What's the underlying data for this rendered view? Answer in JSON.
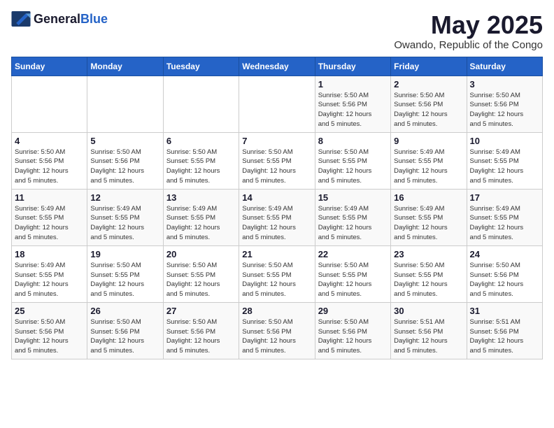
{
  "header": {
    "logo_general": "General",
    "logo_blue": "Blue",
    "month_title": "May 2025",
    "subtitle": "Owando, Republic of the Congo"
  },
  "days_of_week": [
    "Sunday",
    "Monday",
    "Tuesday",
    "Wednesday",
    "Thursday",
    "Friday",
    "Saturday"
  ],
  "weeks": [
    [
      {
        "day": "",
        "info": ""
      },
      {
        "day": "",
        "info": ""
      },
      {
        "day": "",
        "info": ""
      },
      {
        "day": "",
        "info": ""
      },
      {
        "day": "1",
        "info": "Sunrise: 5:50 AM\nSunset: 5:56 PM\nDaylight: 12 hours\nand 5 minutes."
      },
      {
        "day": "2",
        "info": "Sunrise: 5:50 AM\nSunset: 5:56 PM\nDaylight: 12 hours\nand 5 minutes."
      },
      {
        "day": "3",
        "info": "Sunrise: 5:50 AM\nSunset: 5:56 PM\nDaylight: 12 hours\nand 5 minutes."
      }
    ],
    [
      {
        "day": "4",
        "info": "Sunrise: 5:50 AM\nSunset: 5:56 PM\nDaylight: 12 hours\nand 5 minutes."
      },
      {
        "day": "5",
        "info": "Sunrise: 5:50 AM\nSunset: 5:56 PM\nDaylight: 12 hours\nand 5 minutes."
      },
      {
        "day": "6",
        "info": "Sunrise: 5:50 AM\nSunset: 5:55 PM\nDaylight: 12 hours\nand 5 minutes."
      },
      {
        "day": "7",
        "info": "Sunrise: 5:50 AM\nSunset: 5:55 PM\nDaylight: 12 hours\nand 5 minutes."
      },
      {
        "day": "8",
        "info": "Sunrise: 5:50 AM\nSunset: 5:55 PM\nDaylight: 12 hours\nand 5 minutes."
      },
      {
        "day": "9",
        "info": "Sunrise: 5:49 AM\nSunset: 5:55 PM\nDaylight: 12 hours\nand 5 minutes."
      },
      {
        "day": "10",
        "info": "Sunrise: 5:49 AM\nSunset: 5:55 PM\nDaylight: 12 hours\nand 5 minutes."
      }
    ],
    [
      {
        "day": "11",
        "info": "Sunrise: 5:49 AM\nSunset: 5:55 PM\nDaylight: 12 hours\nand 5 minutes."
      },
      {
        "day": "12",
        "info": "Sunrise: 5:49 AM\nSunset: 5:55 PM\nDaylight: 12 hours\nand 5 minutes."
      },
      {
        "day": "13",
        "info": "Sunrise: 5:49 AM\nSunset: 5:55 PM\nDaylight: 12 hours\nand 5 minutes."
      },
      {
        "day": "14",
        "info": "Sunrise: 5:49 AM\nSunset: 5:55 PM\nDaylight: 12 hours\nand 5 minutes."
      },
      {
        "day": "15",
        "info": "Sunrise: 5:49 AM\nSunset: 5:55 PM\nDaylight: 12 hours\nand 5 minutes."
      },
      {
        "day": "16",
        "info": "Sunrise: 5:49 AM\nSunset: 5:55 PM\nDaylight: 12 hours\nand 5 minutes."
      },
      {
        "day": "17",
        "info": "Sunrise: 5:49 AM\nSunset: 5:55 PM\nDaylight: 12 hours\nand 5 minutes."
      }
    ],
    [
      {
        "day": "18",
        "info": "Sunrise: 5:49 AM\nSunset: 5:55 PM\nDaylight: 12 hours\nand 5 minutes."
      },
      {
        "day": "19",
        "info": "Sunrise: 5:50 AM\nSunset: 5:55 PM\nDaylight: 12 hours\nand 5 minutes."
      },
      {
        "day": "20",
        "info": "Sunrise: 5:50 AM\nSunset: 5:55 PM\nDaylight: 12 hours\nand 5 minutes."
      },
      {
        "day": "21",
        "info": "Sunrise: 5:50 AM\nSunset: 5:55 PM\nDaylight: 12 hours\nand 5 minutes."
      },
      {
        "day": "22",
        "info": "Sunrise: 5:50 AM\nSunset: 5:55 PM\nDaylight: 12 hours\nand 5 minutes."
      },
      {
        "day": "23",
        "info": "Sunrise: 5:50 AM\nSunset: 5:55 PM\nDaylight: 12 hours\nand 5 minutes."
      },
      {
        "day": "24",
        "info": "Sunrise: 5:50 AM\nSunset: 5:56 PM\nDaylight: 12 hours\nand 5 minutes."
      }
    ],
    [
      {
        "day": "25",
        "info": "Sunrise: 5:50 AM\nSunset: 5:56 PM\nDaylight: 12 hours\nand 5 minutes."
      },
      {
        "day": "26",
        "info": "Sunrise: 5:50 AM\nSunset: 5:56 PM\nDaylight: 12 hours\nand 5 minutes."
      },
      {
        "day": "27",
        "info": "Sunrise: 5:50 AM\nSunset: 5:56 PM\nDaylight: 12 hours\nand 5 minutes."
      },
      {
        "day": "28",
        "info": "Sunrise: 5:50 AM\nSunset: 5:56 PM\nDaylight: 12 hours\nand 5 minutes."
      },
      {
        "day": "29",
        "info": "Sunrise: 5:50 AM\nSunset: 5:56 PM\nDaylight: 12 hours\nand 5 minutes."
      },
      {
        "day": "30",
        "info": "Sunrise: 5:51 AM\nSunset: 5:56 PM\nDaylight: 12 hours\nand 5 minutes."
      },
      {
        "day": "31",
        "info": "Sunrise: 5:51 AM\nSunset: 5:56 PM\nDaylight: 12 hours\nand 5 minutes."
      }
    ]
  ]
}
